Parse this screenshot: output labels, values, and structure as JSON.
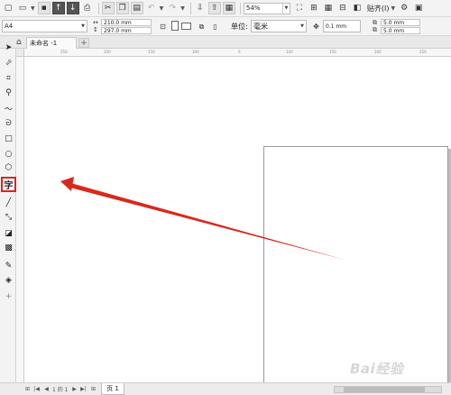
{
  "toolbar": {
    "zoom_level": "54%",
    "snap_label": "贴齐(I)"
  },
  "property_bar": {
    "paper_size": "A4",
    "width": "210.0 mm",
    "height": "297.0 mm",
    "units_label": "单位:",
    "units_value": "毫米",
    "nudge": "0.1 mm",
    "dup_x": "5.0 mm",
    "dup_y": "5.0 mm"
  },
  "tabs": {
    "document_tab": "未命名 -1"
  },
  "toolbox": {
    "highlighted_tool_glyph": "字",
    "highlight_color": "#e02020"
  },
  "rulers": {
    "h_ticks": [
      "250",
      "200",
      "150",
      "100",
      "50",
      "0",
      "50",
      "100",
      "150",
      "200",
      "250"
    ]
  },
  "annotation": {
    "arrow_color": "#d9281c"
  },
  "page_nav": {
    "counter": "1 的 1",
    "page_tab": "页 1"
  },
  "watermark": {
    "text": "Bai经验"
  }
}
